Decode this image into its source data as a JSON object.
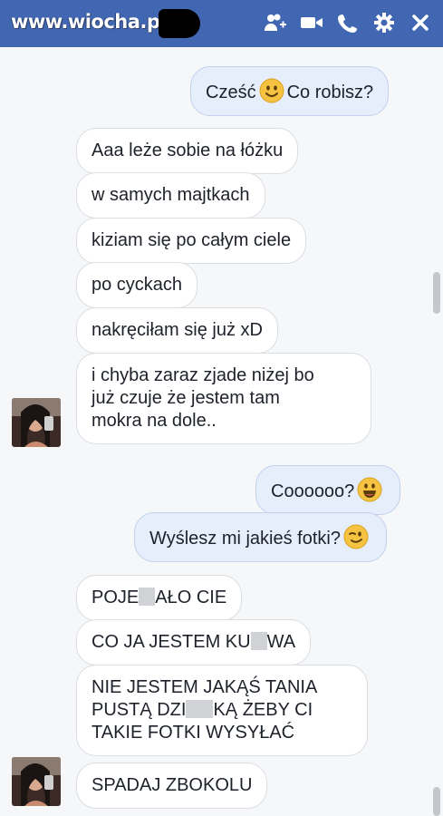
{
  "header": {
    "watermark": "www.wiocha.pl",
    "icons": [
      "add-person-icon",
      "video-call-icon",
      "phone-icon",
      "gear-icon",
      "close-icon"
    ]
  },
  "messages": [
    {
      "dir": "out",
      "parts": [
        "Cześć",
        "Co robisz?"
      ],
      "emoji": "smile"
    },
    {
      "dir": "in",
      "text": "Aaa leże sobie na łóżku"
    },
    {
      "dir": "in",
      "text": "w samych majtkach"
    },
    {
      "dir": "in",
      "text": "kiziam się po całym ciele"
    },
    {
      "dir": "in",
      "text": "po cyckach"
    },
    {
      "dir": "in",
      "text": "nakręciłam się już xD"
    },
    {
      "dir": "in",
      "lines": [
        "i chyba zaraz zjade niżej bo",
        "już czuje że jestem tam",
        "mokra na dole.."
      ]
    },
    {
      "dir": "out",
      "text": "Coooooo?",
      "emoji": "grin"
    },
    {
      "dir": "out",
      "text": "Wyślesz mi jakieś fotki?",
      "emoji": "wink"
    },
    {
      "dir": "in",
      "parts": [
        "POJE",
        "AŁO CIE"
      ]
    },
    {
      "dir": "in",
      "parts": [
        "CO JA JESTEM KU",
        "WA"
      ]
    },
    {
      "dir": "in",
      "lines": [
        "NIE JESTEM JAKĄŚ TANIA",
        "PUSTĄ DZI",
        "KĄ ŻEBY CI",
        "TAKIE FOTKI WYSYŁAĆ"
      ]
    },
    {
      "dir": "in",
      "text": "SPADAJ ZBOKOLU"
    }
  ],
  "colors": {
    "header": "#4267b2",
    "out_bubble": "#e6eefc",
    "in_bubble": "#ffffff",
    "emoji": "#f5c242"
  }
}
